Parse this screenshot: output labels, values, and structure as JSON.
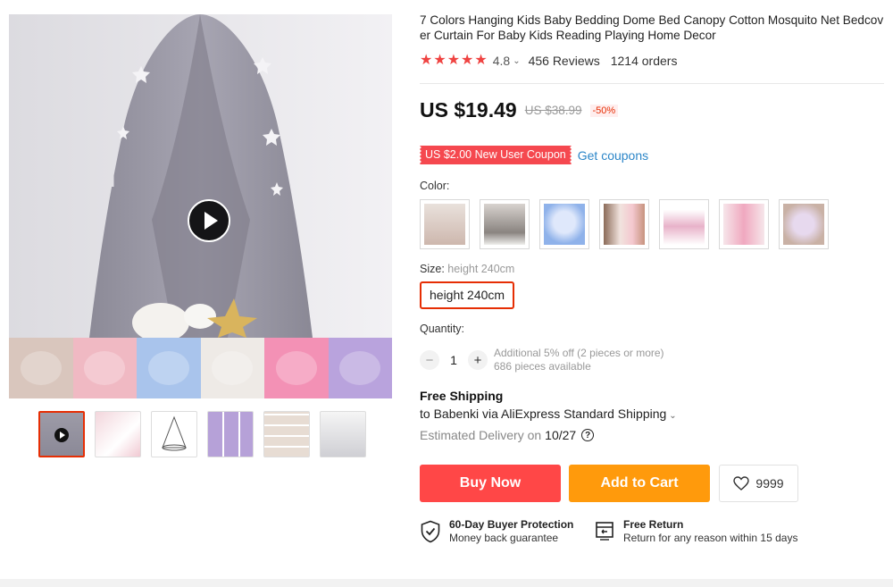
{
  "product": {
    "title": "7 Colors Hanging Kids Baby Bedding Dome Bed Canopy Cotton Mosquito Net Bedcover Curtain For Baby Kids Reading Playing Home Decor",
    "rating": "4.8",
    "rating_stars": 5,
    "reviews": "456 Reviews",
    "orders": "1214 orders"
  },
  "price": {
    "current": "US $19.49",
    "original": "US $38.99",
    "discount": "-50%"
  },
  "coupon": {
    "label": "US $2.00 New User Coupon",
    "link": "Get coupons"
  },
  "color": {
    "label": "Color:",
    "swatches": [
      "swatch-1",
      "swatch-2",
      "swatch-3",
      "swatch-4",
      "swatch-5",
      "swatch-6",
      "swatch-7"
    ]
  },
  "size": {
    "label": "Size:",
    "selected": "height 240cm",
    "option": "height 240cm"
  },
  "quantity": {
    "label": "Quantity:",
    "value": "1",
    "minus": "−",
    "plus": "+",
    "note1": "Additional 5% off (2 pieces or more)",
    "note2": "686 pieces available"
  },
  "shipping": {
    "title": "Free Shipping",
    "detail": "to Babenki via AliExpress Standard Shipping",
    "delivery_label": "Estimated Delivery on",
    "delivery_date": "10/27"
  },
  "actions": {
    "buy_now": "Buy Now",
    "add_to_cart": "Add to Cart",
    "wishlist_count": "9999"
  },
  "guarantees": [
    {
      "title": "60-Day Buyer Protection",
      "subtitle": "Money back guarantee"
    },
    {
      "title": "Free Return",
      "subtitle": "Return for any reason within 15 days"
    }
  ],
  "colors": {
    "accent_red": "#ff4747",
    "accent_orange": "#ff9a0c",
    "star_red": "#ef4341",
    "link_blue": "#2c86c8"
  }
}
